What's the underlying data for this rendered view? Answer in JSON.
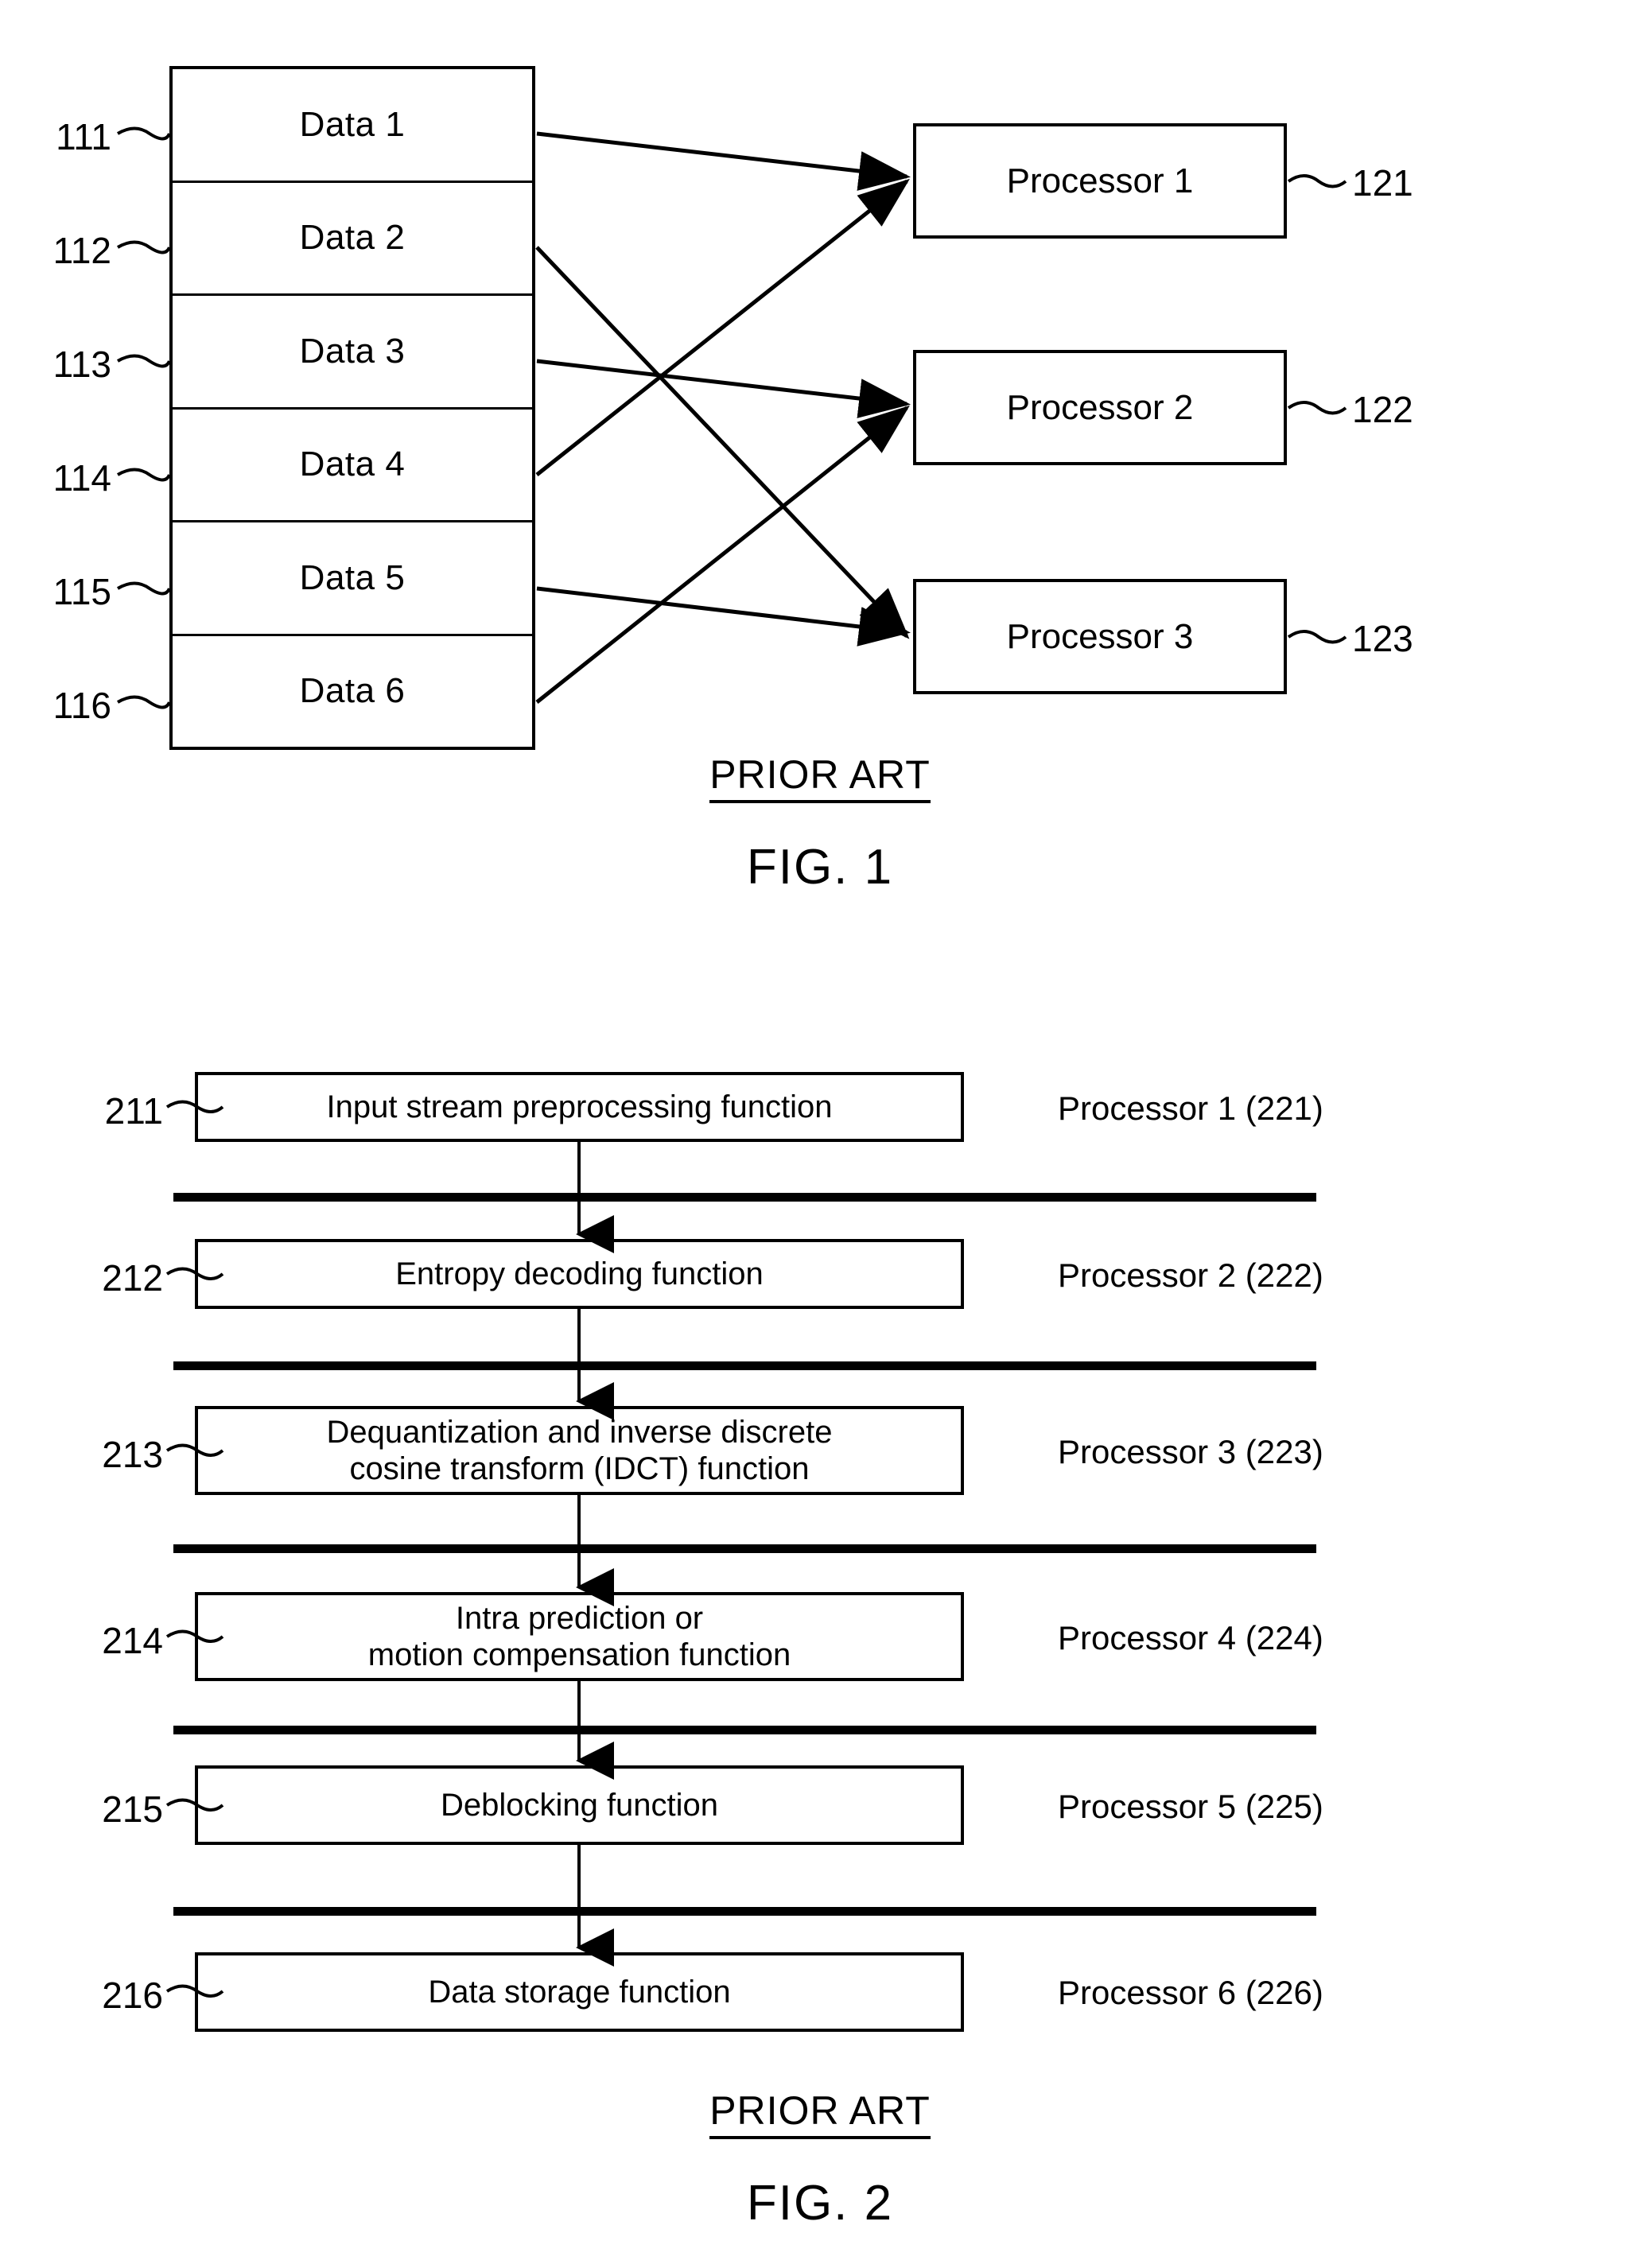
{
  "figure1": {
    "data_blocks": [
      {
        "ref": "111",
        "label": "Data 1"
      },
      {
        "ref": "112",
        "label": "Data 2"
      },
      {
        "ref": "113",
        "label": "Data 3"
      },
      {
        "ref": "114",
        "label": "Data 4"
      },
      {
        "ref": "115",
        "label": "Data 5"
      },
      {
        "ref": "116",
        "label": "Data 6"
      }
    ],
    "processors": [
      {
        "ref": "121",
        "label": "Processor 1"
      },
      {
        "ref": "122",
        "label": "Processor 2"
      },
      {
        "ref": "123",
        "label": "Processor 3"
      }
    ],
    "prior_art": "PRIOR ART",
    "fig_caption": "FIG. 1"
  },
  "figure2": {
    "stages": [
      {
        "ref": "211",
        "label": "Input stream preprocessing function",
        "processor": "Processor 1 (221)"
      },
      {
        "ref": "212",
        "label": "Entropy decoding function",
        "processor": "Processor 2 (222)"
      },
      {
        "ref": "213",
        "label": "Dequantization and inverse discrete cosine transform (IDCT) function",
        "processor": "Processor 3 (223)"
      },
      {
        "ref": "214",
        "label": "Intra prediction or motion compensation function",
        "processor": "Processor 4 (224)"
      },
      {
        "ref": "215",
        "label": "Deblocking function",
        "processor": "Processor 5 (225)"
      },
      {
        "ref": "216",
        "label": "Data storage function",
        "processor": "Processor 6 (226)"
      }
    ],
    "stage_labels_line1": [
      "Input stream preprocessing function",
      "Entropy decoding function",
      "Dequantization and inverse discrete",
      "Intra prediction or",
      "Deblocking function",
      "Data storage function"
    ],
    "stage_labels_line2": [
      "",
      "",
      "cosine transform (IDCT) function",
      "motion compensation function",
      "",
      ""
    ],
    "prior_art": "PRIOR ART",
    "fig_caption": "FIG. 2"
  },
  "colors": {
    "ink": "#000000",
    "paper": "#ffffff"
  }
}
